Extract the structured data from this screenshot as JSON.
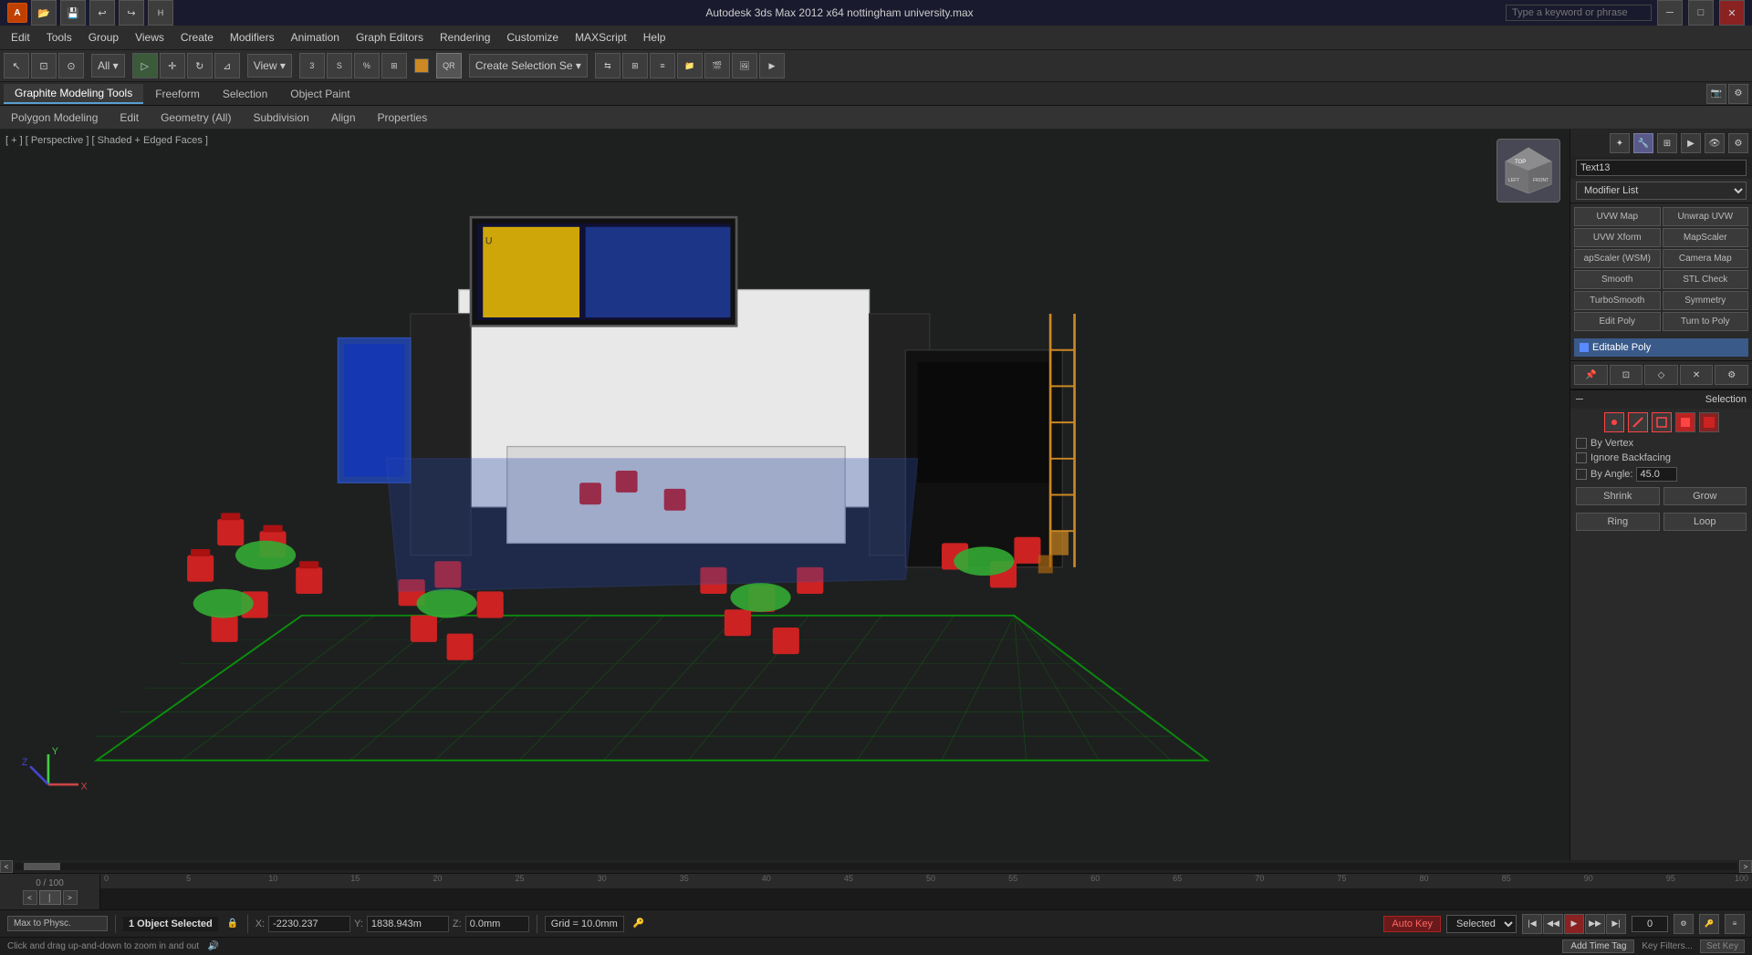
{
  "titlebar": {
    "logo": "autodesk-logo",
    "file_icons": [
      "open",
      "save",
      "undo",
      "redo"
    ],
    "title": "Autodesk 3ds Max  2012 x64    nottingham university.max",
    "search_placeholder": "Type a keyword or phrase",
    "window_controls": [
      "minimize",
      "maximize",
      "close"
    ]
  },
  "menubar": {
    "items": [
      {
        "label": "Edit",
        "id": "menu-edit"
      },
      {
        "label": "Tools",
        "id": "menu-tools"
      },
      {
        "label": "Group",
        "id": "menu-group"
      },
      {
        "label": "Views",
        "id": "menu-views"
      },
      {
        "label": "Create",
        "id": "menu-create"
      },
      {
        "label": "Modifiers",
        "id": "menu-modifiers"
      },
      {
        "label": "Animation",
        "id": "menu-animation"
      },
      {
        "label": "Graph Editors",
        "id": "menu-graph-editors"
      },
      {
        "label": "Rendering",
        "id": "menu-rendering"
      },
      {
        "label": "Customize",
        "id": "menu-customize"
      },
      {
        "label": "MAXScript",
        "id": "menu-maxscript"
      },
      {
        "label": "Help",
        "id": "menu-help"
      }
    ]
  },
  "graphite_tabs": {
    "items": [
      {
        "label": "Graphite Modeling Tools",
        "active": true
      },
      {
        "label": "Freeform"
      },
      {
        "label": "Selection"
      },
      {
        "label": "Object Paint"
      }
    ],
    "camera_icon": "camera-icon",
    "settings_icon": "settings-icon"
  },
  "ribbon": {
    "items": [
      {
        "label": "Polygon Modeling"
      },
      {
        "label": "Edit"
      },
      {
        "label": "Geometry (All)"
      },
      {
        "label": "Subdivision"
      },
      {
        "label": "Align"
      },
      {
        "label": "Properties"
      }
    ]
  },
  "viewport": {
    "label": "[ + ] [ Perspective ] [ Shaded + Edged Faces ]",
    "perspective": "Perspective",
    "mode": "Shaded + Edged Faces"
  },
  "right_panel": {
    "icons_top": [
      "sun",
      "camera",
      "hierarchy",
      "display",
      "utilities",
      "lock"
    ],
    "object_name": "Text13",
    "modifier_list_label": "Modifier List",
    "modifiers": [
      {
        "label": "UVW Map",
        "col": 1
      },
      {
        "label": "Unwrap UVW",
        "col": 2
      },
      {
        "label": "UVW Xform",
        "col": 1
      },
      {
        "label": "MapScaler",
        "col": 2
      },
      {
        "label": "apScaler (WSM)",
        "col": 1
      },
      {
        "label": "Camera Map",
        "col": 2
      },
      {
        "label": "Smooth",
        "col": 1
      },
      {
        "label": "STL Check",
        "col": 2
      },
      {
        "label": "TurboSmooth",
        "col": 1
      },
      {
        "label": "Symmetry",
        "col": 2
      },
      {
        "label": "Edit Poly",
        "col": 1
      },
      {
        "label": "Turn to Poly",
        "col": 2
      }
    ],
    "stack": [
      {
        "label": "Editable Poly",
        "active": true,
        "color": "#3a5a8a"
      }
    ],
    "selection_section": {
      "label": "Selection",
      "icons": [
        "vertex",
        "edge",
        "border",
        "polygon-big",
        "element-bigger"
      ],
      "by_vertex": "By Vertex",
      "ignore_backfacing": "Ignore Backfacing",
      "by_angle_label": "By Angle:",
      "by_angle_value": "45.0",
      "shrink": "Shrink",
      "grow": "Grow",
      "ring_label": "Ring",
      "loop_label": "Loop"
    }
  },
  "timeline": {
    "progress": "0 / 100",
    "ticks": [
      0,
      5,
      10,
      15,
      20,
      25,
      30,
      35,
      40,
      45,
      50,
      55,
      60,
      65,
      70,
      75,
      80,
      85,
      90,
      95,
      100
    ]
  },
  "statusbar": {
    "object_selected": "1 Object Selected",
    "hint": "Click and drag up-and-down to zoom in and out",
    "x_label": "X:",
    "x_value": "-2230.237",
    "y_label": "Y:",
    "y_value": "1838.943m",
    "z_label": "Z:",
    "z_value": "0.0mm",
    "grid_label": "Grid = 10.0mm",
    "auto_key": "Auto Key",
    "selected_label": "Selected",
    "set_key_label": "Set Key",
    "add_time_tag": "Add Time Tag",
    "key_filters_label": "Key Filters...",
    "transport_buttons": [
      "prev-start",
      "prev-key",
      "play",
      "next-key",
      "next-end"
    ],
    "frame_input": "0",
    "max_to_physx": "Max to Physc."
  }
}
